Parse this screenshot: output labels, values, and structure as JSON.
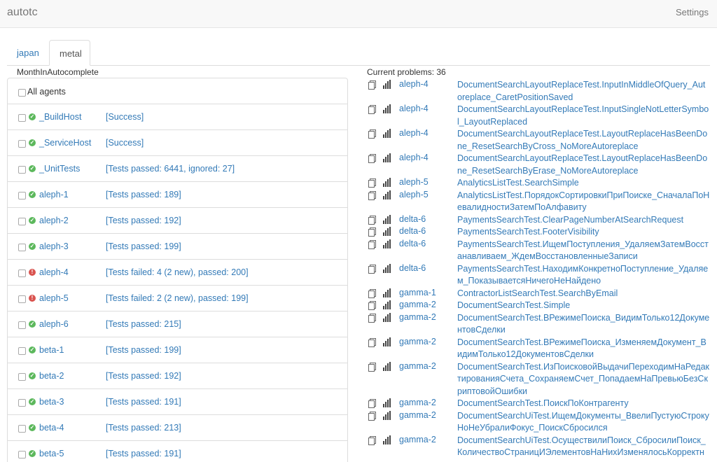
{
  "header": {
    "brand": "autotc",
    "settings": "Settings"
  },
  "tabs": [
    {
      "label": "japan"
    },
    {
      "label": "metal"
    }
  ],
  "build_config": "MonthInAutocomplete",
  "all_agents_label": "All agents",
  "agents": [
    {
      "name": "_BuildHost",
      "status": "[Success]",
      "state": "ok"
    },
    {
      "name": "_ServiceHost",
      "status": "[Success]",
      "state": "ok"
    },
    {
      "name": "_UnitTests",
      "status": "[Tests passed: 6441, ignored: 27]",
      "state": "ok"
    },
    {
      "name": "aleph-1",
      "status": "[Tests passed: 189]",
      "state": "ok"
    },
    {
      "name": "aleph-2",
      "status": "[Tests passed: 192]",
      "state": "ok"
    },
    {
      "name": "aleph-3",
      "status": "[Tests passed: 199]",
      "state": "ok"
    },
    {
      "name": "aleph-4",
      "status": "[Tests failed: 4 (2 new), passed: 200]",
      "state": "error"
    },
    {
      "name": "aleph-5",
      "status": "[Tests failed: 2 (2 new), passed: 199]",
      "state": "error"
    },
    {
      "name": "aleph-6",
      "status": "[Tests passed: 215]",
      "state": "ok"
    },
    {
      "name": "beta-1",
      "status": "[Tests passed: 199]",
      "state": "ok"
    },
    {
      "name": "beta-2",
      "status": "[Tests passed: 192]",
      "state": "ok"
    },
    {
      "name": "beta-3",
      "status": "[Tests passed: 191]",
      "state": "ok"
    },
    {
      "name": "beta-4",
      "status": "[Tests passed: 213]",
      "state": "ok"
    },
    {
      "name": "beta-5",
      "status": "[Tests passed: 191]",
      "state": "ok"
    }
  ],
  "problems_title": "Current problems: 36",
  "problems": [
    {
      "agent": "aleph-4",
      "test": "DocumentSearchLayoutReplaceTest.InputInMiddleOfQuery_Autoreplace_CaretPositionSaved"
    },
    {
      "agent": "aleph-4",
      "test": "DocumentSearchLayoutReplaceTest.InputSingleNotLetterSymbol_LayoutReplaced"
    },
    {
      "agent": "aleph-4",
      "test": "DocumentSearchLayoutReplaceTest.LayoutReplaceHasBeenDone_ResetSearchByCross_NoMoreAutoreplace"
    },
    {
      "agent": "aleph-4",
      "test": "DocumentSearchLayoutReplaceTest.LayoutReplaceHasBeenDone_ResetSearchByErase_NoMoreAutoreplace"
    },
    {
      "agent": "aleph-5",
      "test": "AnalyticsListTest.SearchSimple"
    },
    {
      "agent": "aleph-5",
      "test": "AnalyticsListTest.ПорядокСортировкиПриПоиске_СначалаПоНевалидностиЗатемПоАлфавиту"
    },
    {
      "agent": "delta-6",
      "test": "PaymentsSearchTest.ClearPageNumberAtSearchRequest"
    },
    {
      "agent": "delta-6",
      "test": "PaymentsSearchTest.FooterVisibility"
    },
    {
      "agent": "delta-6",
      "test": "PaymentsSearchTest.ИщемПоступления_УдаляемЗатемВосстанавливаем_ЖдемВосстановленныеЗаписи"
    },
    {
      "agent": "delta-6",
      "test": "PaymentsSearchTest.НаходимКонкретноПоступление_Удаляем_ПоказываетсяНичегоНеНайдено"
    },
    {
      "agent": "gamma-1",
      "test": "ContractorListSearchTest.SearchByEmail"
    },
    {
      "agent": "gamma-2",
      "test": "DocumentSearchTest.Simple"
    },
    {
      "agent": "gamma-2",
      "test": "DocumentSearchTest.ВРежимеПоиска_ВидимТолько12ДокументовСделки"
    },
    {
      "agent": "gamma-2",
      "test": "DocumentSearchTest.ВРежимеПоиска_ИзменяемДокумент_ВидимТолько12ДокументовСделки"
    },
    {
      "agent": "gamma-2",
      "test": "DocumentSearchTest.ИзПоисковойВыдачиПереходимНаРедактированияСчета_СохраняемСчет_ПопадаемНаПревьюБезСкриптовойОшибки"
    },
    {
      "agent": "gamma-2",
      "test": "DocumentSearchTest.ПоискПоКонтрагенту"
    },
    {
      "agent": "gamma-2",
      "test": "DocumentSearchUiTest.ИщемДокументы_ВвелиПустуюСтрокуНоНеУбралиФокус_ПоискСбросился"
    },
    {
      "agent": "gamma-2",
      "test": "DocumentSearchUiTest.ОсуществилиПоиск_СбросилиПоиск_КоличествоСтраницИЭлементовНаНихИзменялосьКорректн"
    }
  ]
}
